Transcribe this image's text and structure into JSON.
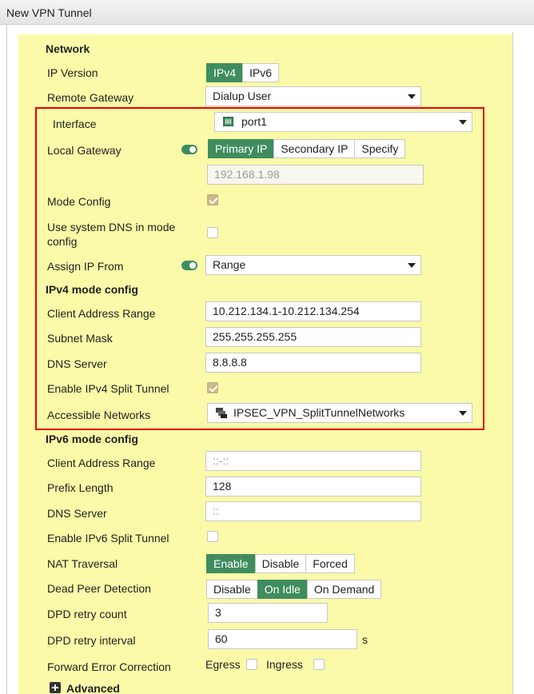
{
  "window": {
    "title": "New VPN Tunnel"
  },
  "sections": {
    "network": "Network",
    "ipv4_mode_config": "IPv4 mode config",
    "ipv6_mode_config": "IPv6 mode config",
    "advanced": "Advanced"
  },
  "fields": {
    "ip_version": {
      "label": "IP Version",
      "options": [
        "IPv4",
        "IPv6"
      ],
      "selected": "IPv4"
    },
    "remote_gateway": {
      "label": "Remote Gateway",
      "value": "Dialup User"
    },
    "interface": {
      "label": "Interface",
      "value": "port1",
      "icon": "port-icon"
    },
    "local_gateway": {
      "label": "Local Gateway",
      "enabled": true,
      "options": [
        "Primary IP",
        "Secondary IP",
        "Specify"
      ],
      "selected": "Primary IP",
      "ip_value": "192.168.1.98"
    },
    "mode_config": {
      "label": "Mode Config",
      "checked": true
    },
    "use_system_dns": {
      "label_line1": "Use system DNS in mode",
      "label_line2": "config",
      "checked": false
    },
    "assign_ip_from": {
      "label": "Assign IP From",
      "enabled": true,
      "value": "Range"
    },
    "ipv4_client_address_range": {
      "label": "Client Address Range",
      "value": "10.212.134.1-10.212.134.254"
    },
    "ipv4_subnet_mask": {
      "label": "Subnet Mask",
      "value": "255.255.255.255"
    },
    "ipv4_dns_server": {
      "label": "DNS Server",
      "value": "8.8.8.8"
    },
    "enable_ipv4_split_tunnel": {
      "label": "Enable IPv4 Split Tunnel",
      "checked": true
    },
    "accessible_networks": {
      "label": "Accessible Networks",
      "value": "IPSEC_VPN_SplitTunnelNetworks",
      "icon": "address-group-icon"
    },
    "ipv6_client_address_range": {
      "label": "Client Address Range",
      "placeholder": "::-::"
    },
    "ipv6_prefix_length": {
      "label": "Prefix Length",
      "value": "128"
    },
    "ipv6_dns_server": {
      "label": "DNS Server",
      "placeholder": "::"
    },
    "enable_ipv6_split_tunnel": {
      "label": "Enable IPv6 Split Tunnel",
      "checked": false
    },
    "nat_traversal": {
      "label": "NAT Traversal",
      "options": [
        "Enable",
        "Disable",
        "Forced"
      ],
      "selected": "Enable"
    },
    "dead_peer_detection": {
      "label": "Dead Peer Detection",
      "options": [
        "Disable",
        "On Idle",
        "On Demand"
      ],
      "selected": "On Idle"
    },
    "dpd_retry_count": {
      "label": "DPD retry count",
      "value": "3"
    },
    "dpd_retry_interval": {
      "label": "DPD retry interval",
      "value": "60",
      "unit": "s"
    },
    "forward_error_correction": {
      "label": "Forward Error Correction",
      "egress_label": "Egress",
      "ingress_label": "Ingress",
      "egress_checked": false,
      "ingress_checked": false
    }
  },
  "colors": {
    "panel_bg": "#fafaa8",
    "accent_green": "#3f8d5e",
    "highlight_border": "#e8000b"
  }
}
